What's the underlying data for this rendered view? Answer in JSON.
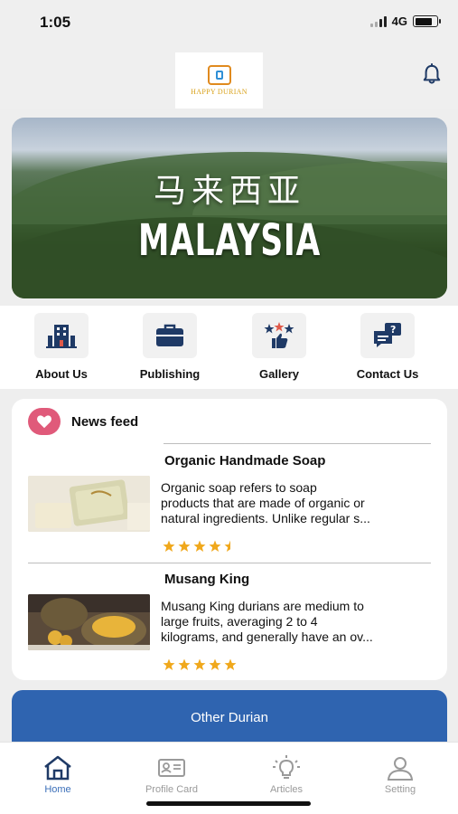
{
  "status_bar": {
    "time": "1:05",
    "network": "4G"
  },
  "header": {
    "logo_text": "HAPPY DURIAN"
  },
  "banner": {
    "title_cn": "马来西亚",
    "title_en": "MALAYSIA"
  },
  "quick_menu": [
    {
      "label": "About Us",
      "icon": "building-icon"
    },
    {
      "label": "Publishing",
      "icon": "briefcase-icon"
    },
    {
      "label": "Gallery",
      "icon": "stars-thumbsup-icon"
    },
    {
      "label": "Contact Us",
      "icon": "chat-question-icon"
    }
  ],
  "news_feed": {
    "title": "News feed",
    "items": [
      {
        "title": "Organic Handmade Soap",
        "desc_lines": [
          "Organic soap refers to soap",
          "products that are made of organic or",
          "natural ingredients. Unlike regular s..."
        ],
        "rating": 4.5
      },
      {
        "title": "Musang King",
        "desc_lines": [
          "Musang King durians are medium to",
          "large fruits, averaging 2 to 4",
          "kilograms, and generally have an ov..."
        ],
        "rating": 5
      }
    ]
  },
  "other_button": {
    "label": "Other Durian"
  },
  "tabs": [
    {
      "label": "Home",
      "active": true
    },
    {
      "label": "Profile Card",
      "active": false
    },
    {
      "label": "Articles",
      "active": false
    },
    {
      "label": "Setting",
      "active": false
    }
  ],
  "colors": {
    "accent": "#2f64b0",
    "star": "#f0a81c",
    "heart": "#e05a7a",
    "active_tab": "#3b6fb9"
  }
}
